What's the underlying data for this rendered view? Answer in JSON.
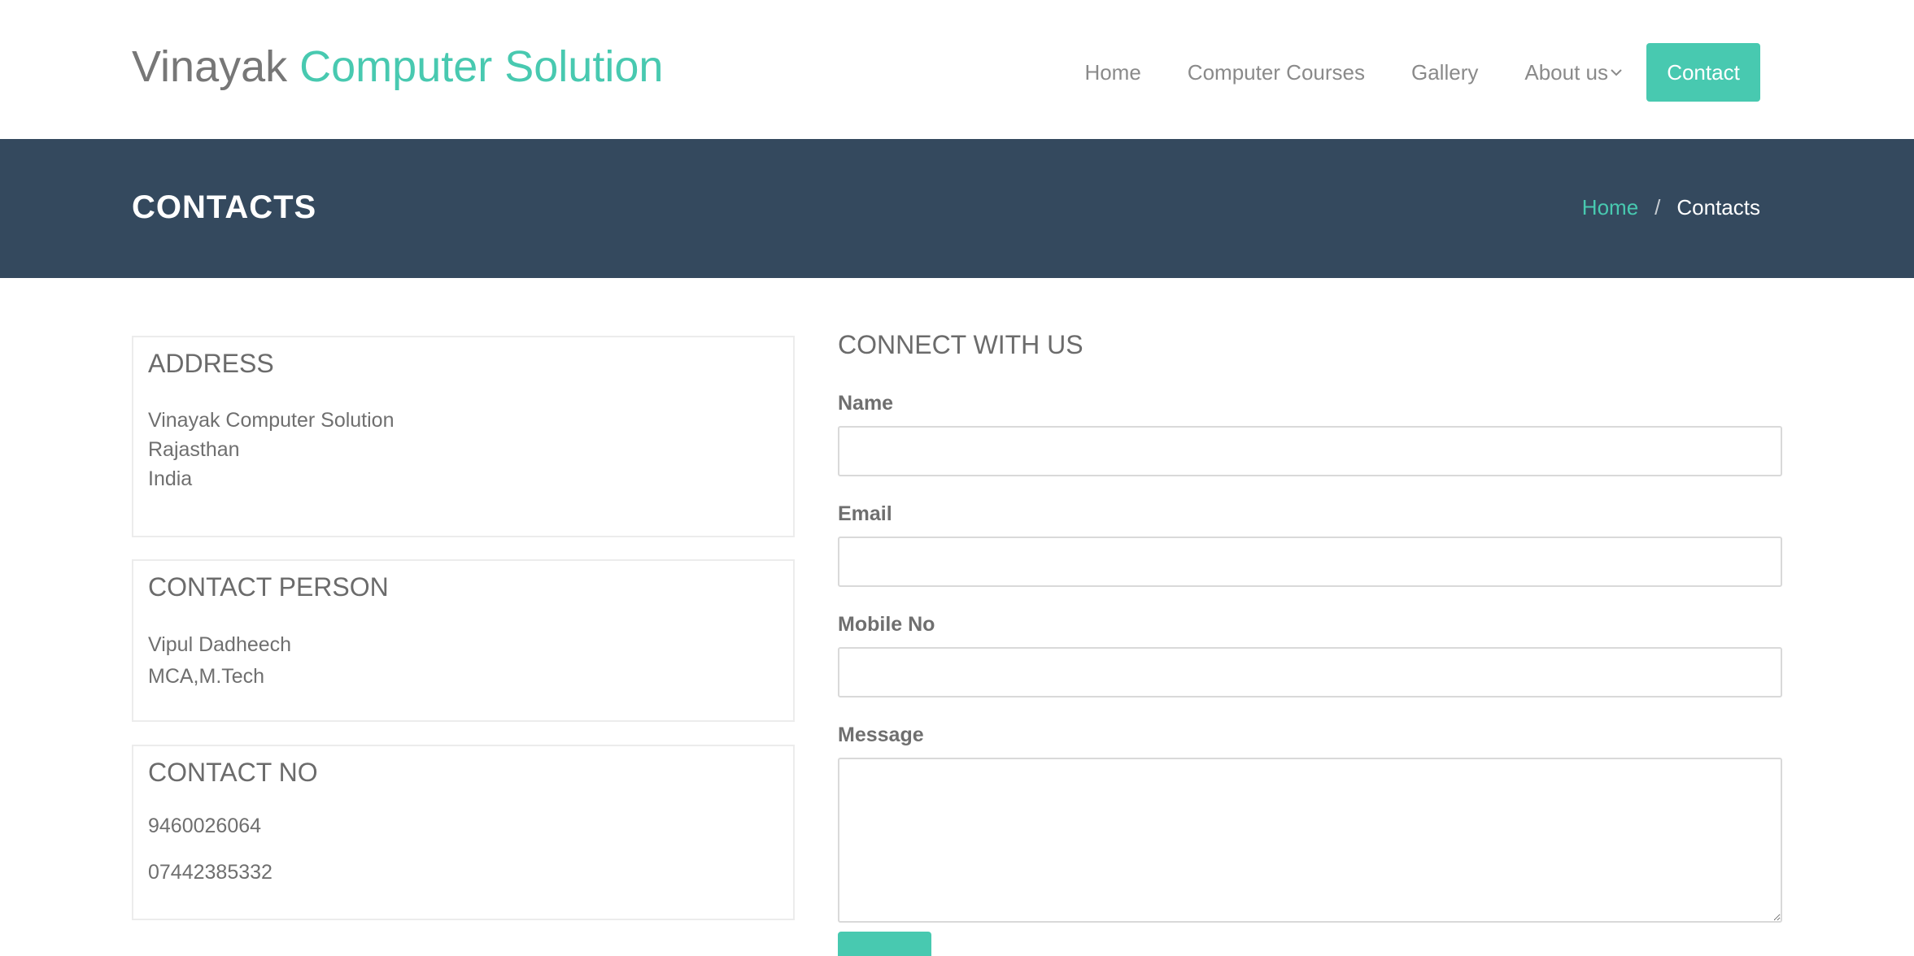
{
  "header": {
    "brand_part1": "Vinayak",
    "brand_part2": "Computer Solution",
    "nav": {
      "home": "Home",
      "courses": "Computer Courses",
      "gallery": "Gallery",
      "about": "About us",
      "contact": "Contact"
    }
  },
  "band": {
    "title": "CONTACTS",
    "breadcrumb": {
      "home": "Home",
      "separator": "/",
      "current": "Contacts"
    }
  },
  "address": {
    "title": "ADDRESS",
    "lines": [
      "Vinayak Computer Solution",
      "Rajasthan",
      "India"
    ]
  },
  "contact_person": {
    "title": "CONTACT PERSON",
    "lines": [
      "Vipul Dadheech",
      "MCA,M.Tech"
    ]
  },
  "contact_no": {
    "title": "CONTACT NO",
    "lines": [
      "9460026064",
      "07442385332"
    ]
  },
  "form": {
    "title": "CONNECT WITH US",
    "name_label": "Name",
    "email_label": "Email",
    "mobile_label": "Mobile No",
    "message_label": "Message",
    "name_value": "",
    "email_value": "",
    "mobile_value": "",
    "message_value": ""
  },
  "colors": {
    "accent": "#48c9b0",
    "band": "#34495e",
    "text": "#666666"
  },
  "icons": {
    "about_dropdown": "chevron-down-icon",
    "textarea_resize": "resize-grip-icon"
  }
}
